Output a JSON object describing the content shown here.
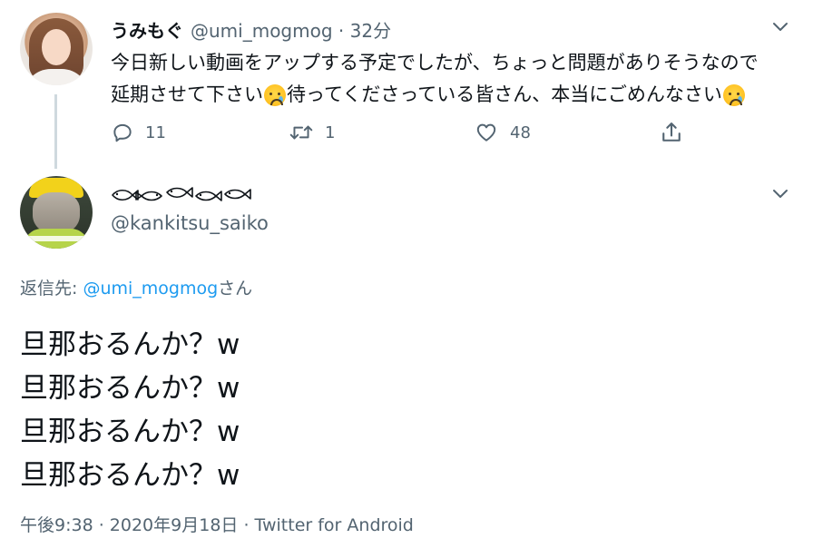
{
  "parent_tweet": {
    "display_name": "うみもぐ",
    "handle_meta": "@umi_mogmog · 32分",
    "text_line_1": "今日新しい動画をアップする予定でしたが、ちょっと問題がありそうなので",
    "text_line_2_a": "延期させて下さい",
    "text_line_2_b": "待ってくださっている皆さん、本当にごめんなさい",
    "emoji": "crying-face",
    "reply_count": "11",
    "retweet_count": "1",
    "like_count": "48",
    "icons": [
      "reply-icon",
      "retweet-icon",
      "like-icon",
      "share-icon",
      "chevron-down-icon"
    ]
  },
  "reply_tweet": {
    "display_name_icons": "fish-icons",
    "handle": "@kankitsu_saiko",
    "replying_prefix": "返信先: ",
    "replying_mention": "@umi_mogmog",
    "replying_suffix": "さん",
    "body_lines": [
      "旦那おるんか？w",
      "旦那おるんか？w",
      "旦那おるんか？w",
      "旦那おるんか？w"
    ],
    "timestamp_source": "午後9:38 · 2020年9月18日 · Twitter for Android"
  },
  "colors": {
    "text_primary": "#0f1419",
    "text_secondary": "#536471",
    "link": "#1d9bf0",
    "thread_line": "#cfd9de"
  }
}
